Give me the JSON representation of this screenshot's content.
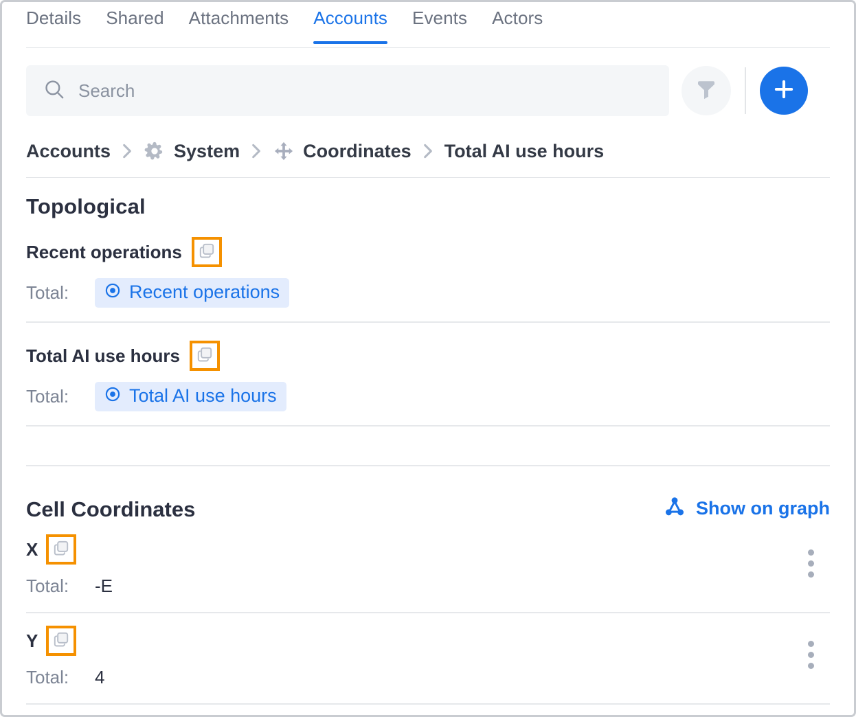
{
  "tabs": [
    {
      "label": "Details",
      "active": false
    },
    {
      "label": "Shared",
      "active": false
    },
    {
      "label": "Attachments",
      "active": false
    },
    {
      "label": "Accounts",
      "active": true
    },
    {
      "label": "Events",
      "active": false
    },
    {
      "label": "Actors",
      "active": false
    }
  ],
  "search": {
    "placeholder": "Search",
    "value": "",
    "icon": "search-icon"
  },
  "toolbar": {
    "filter_icon": "filter-funnel-icon",
    "add_icon": "plus-icon",
    "add_color": "#1a73e8"
  },
  "breadcrumb": [
    {
      "label": "Accounts",
      "icon": null
    },
    {
      "label": "System",
      "icon": "gear-icon"
    },
    {
      "label": "Coordinates",
      "icon": "move-arrows-icon"
    },
    {
      "label": "Total AI use hours",
      "icon": null
    }
  ],
  "breadcrumb_separator": "chevron-right-icon",
  "topological": {
    "title": "Topological",
    "fields": [
      {
        "label": "Recent operations",
        "copy_icon": "copy-icon",
        "total_label": "Total:",
        "chip": {
          "text": "Recent operations",
          "icon": "target-dot-icon"
        }
      },
      {
        "label": "Total AI use hours",
        "copy_icon": "copy-icon",
        "total_label": "Total:",
        "chip": {
          "text": "Total AI use hours",
          "icon": "target-dot-icon"
        }
      }
    ]
  },
  "cell_coordinates": {
    "title": "Cell Coordinates",
    "show_on_graph": {
      "label": "Show on graph",
      "icon": "graph-nodes-icon"
    },
    "rows": [
      {
        "label": "X",
        "copy_icon": "copy-icon",
        "total_label": "Total:",
        "value": "-E",
        "menu_icon": "kebab-menu-icon"
      },
      {
        "label": "Y",
        "copy_icon": "copy-icon",
        "total_label": "Total:",
        "value": "4",
        "menu_icon": "kebab-menu-icon"
      }
    ]
  },
  "colors": {
    "accent": "#1a73e8",
    "highlight": "#f59100",
    "chip_bg": "#e3ecfd",
    "muted_text": "#7c8494",
    "heading_text": "#2b3040"
  }
}
